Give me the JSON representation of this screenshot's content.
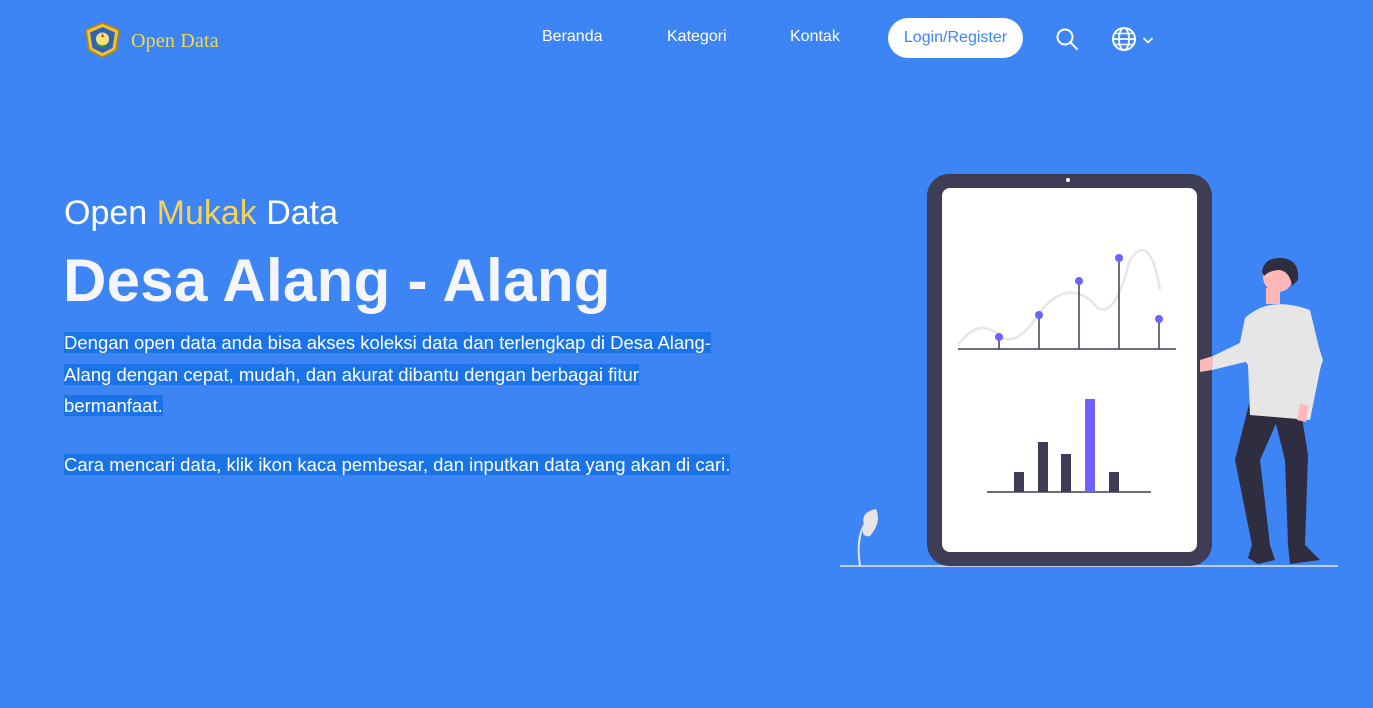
{
  "header": {
    "logo_text": "Open Data",
    "nav": {
      "home": "Beranda",
      "category": "Kategori",
      "contact": "Kontak"
    },
    "login_label": "Login/Register",
    "search_icon": "search-icon",
    "language_icon": "globe-icon"
  },
  "hero": {
    "subtitle_before": "Open ",
    "subtitle_accent": "Mukak",
    "subtitle_after": " Data",
    "title": "Desa Alang - Alang",
    "paragraph_1": "Dengan open data anda bisa akses koleksi data dan terlengkap di Desa Alang-Alang dengan cepat, mudah, dan akurat dibantu dengan berbagai fitur bermanfaat.",
    "paragraph_2": "Cara mencari data, klik ikon kaca pembesar, dan inputkan data yang akan di cari."
  },
  "colors": {
    "background": "#3d84f5",
    "accent": "#f7d354",
    "selection": "#1a74e8",
    "tablet_frame": "#3f3d56",
    "chart_highlight": "#6c63ff"
  }
}
